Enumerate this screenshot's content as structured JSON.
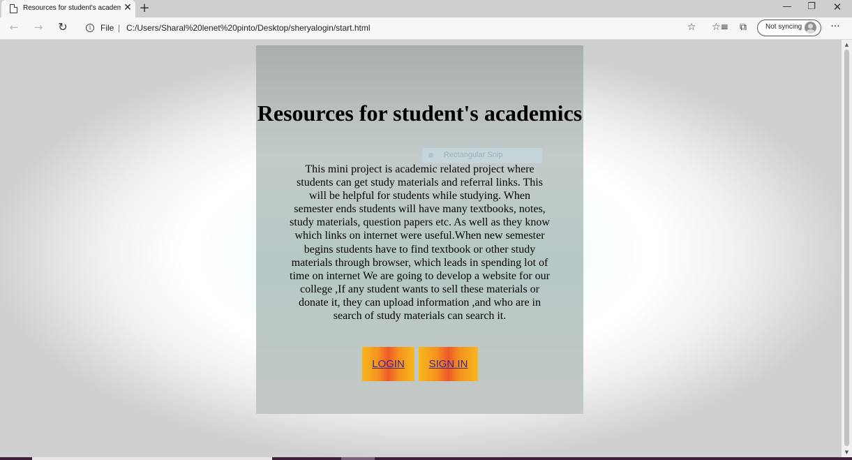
{
  "browser": {
    "tab_title": "Resources for student's academics",
    "tab_close": "✕",
    "new_tab": "+",
    "window_controls": {
      "minimize": "—",
      "maximize": "❐",
      "close": "✕"
    },
    "nav": {
      "back": "←",
      "forward": "→",
      "reload": "↻"
    },
    "info_icon": "i",
    "file_label": "File",
    "separator": "|",
    "url": "C:/Users/Sharal%20lenet%20pinto/Desktop/sheryalogin/start.html",
    "favorite_icon": "☆",
    "favorites_icon": "☆≡",
    "collections_icon": "⧉",
    "sync_label": "Not syncing",
    "more_icon": "···"
  },
  "page": {
    "heading": "Resources for student's academics",
    "description": "This mini project is academic related project where students can get study materials and referral links. This will be helpful for students while studying. When semester ends students will have many textbooks, notes, study materials, question papers etc. As well as they know which links on internet were useful.When new semester begins students have to find textbook or other study materials through browser, which leads in spending lot of time on internet We are going to develop a website for our college ,If any student wants to sell these materials or donate it, they can upload information ,and who are in search of study materials can search it.",
    "overlay_label": "Rectangular Snip",
    "buttons": {
      "login": "LOGIN",
      "signin": "SIGN IN"
    }
  },
  "scrollbar": {
    "up": "▲",
    "down": "▼"
  }
}
